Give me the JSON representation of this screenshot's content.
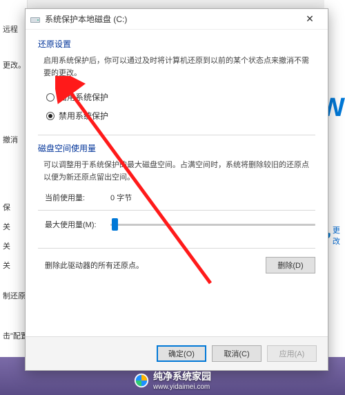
{
  "bg": {
    "left_items": [
      "远程",
      "更改。",
      "保",
      "关",
      "关",
      "关",
      "撤消",
      "制还原",
      "击\"配置"
    ],
    "right_text": "OW",
    "right_link": "更改"
  },
  "dialog": {
    "title": "系统保护本地磁盘 (C:)",
    "close_glyph": "✕",
    "restore": {
      "heading": "还原设置",
      "desc": "启用系统保护后，你可以通过及时将计算机还原到以前的某个状态点来撤消不需要的更改。",
      "opt_enable": "启用系统保护",
      "opt_disable": "禁用系统保护"
    },
    "disk": {
      "heading": "磁盘空间使用量",
      "desc": "可以调整用于系统保护的最大磁盘空间。占满空间时，系统将删除较旧的还原点以便为新还原点留出空间。",
      "current_label": "当前使用量:",
      "current_value": "0 字节",
      "max_label": "最大使用量(M):"
    },
    "delete": {
      "text": "删除此驱动器的所有还原点。",
      "button": "删除(D)"
    },
    "footer": {
      "ok": "确定(O)",
      "cancel": "取消(C)",
      "apply": "应用(A)"
    }
  },
  "watermark": {
    "name": "纯净系统家园",
    "url": "www.yidaimei.com"
  }
}
